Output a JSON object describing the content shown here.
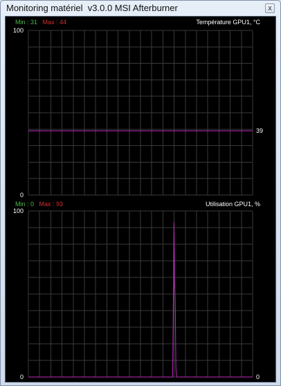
{
  "window": {
    "title": "Monitoring matériel  v3.0.0 MSI Afterburner",
    "close_label": "x"
  },
  "colors": {
    "background": "#000000",
    "grid": "#3a3a3a",
    "line": "#c02cc0",
    "min_text": "#4fb94a",
    "max_text": "#d02f2f"
  },
  "panels": [
    {
      "title": "Température GPU1, °C",
      "min_label": "Min : 31",
      "max_label": "Max : 44",
      "y_max_label": "100",
      "y_min_label": "0",
      "current_label": "39"
    },
    {
      "title": "Utilisation GPU1, %",
      "min_label": "Min : 0",
      "max_label": "Max : 93",
      "y_max_label": "100",
      "y_min_label": "0",
      "current_label": "0"
    }
  ],
  "chart_data": [
    {
      "type": "line",
      "title": "Température GPU1, °C",
      "ylim": [
        0,
        100
      ],
      "grid": true,
      "series": [
        {
          "values": [
            39,
            39,
            39,
            39,
            39,
            39,
            39,
            39,
            39,
            39,
            39,
            39,
            39,
            39,
            39,
            39,
            39,
            39,
            39,
            39,
            39,
            39,
            39,
            39,
            39,
            39,
            39,
            39,
            39,
            39,
            39,
            39,
            39,
            39,
            39,
            39,
            39,
            39,
            39,
            39,
            39,
            39,
            39,
            39,
            39,
            39,
            39,
            39,
            39,
            39,
            39,
            39,
            39,
            39,
            39,
            39,
            39,
            39,
            39,
            39,
            39,
            39,
            39,
            39,
            39,
            39,
            39,
            39,
            39,
            39,
            39,
            39,
            39,
            39,
            39,
            39,
            39,
            39,
            39,
            39
          ]
        }
      ]
    },
    {
      "type": "line",
      "title": "Utilisation GPU1, %",
      "ylim": [
        0,
        100
      ],
      "grid": true,
      "series": [
        {
          "values": [
            0,
            0,
            0,
            0,
            0,
            0,
            0,
            0,
            0,
            0,
            0,
            0,
            0,
            0,
            0,
            0,
            0,
            0,
            0,
            0,
            0,
            0,
            0,
            0,
            0,
            0,
            0,
            0,
            0,
            0,
            0,
            0,
            0,
            0,
            0,
            0,
            0,
            0,
            0,
            0,
            0,
            0,
            0,
            0,
            0,
            0,
            0,
            0,
            0,
            0,
            0,
            0,
            0,
            0,
            0,
            0,
            0,
            0,
            0,
            0,
            0,
            0,
            0,
            0,
            0,
            0,
            0,
            0,
            0,
            0,
            0,
            0,
            0,
            0,
            0,
            0,
            0,
            0,
            0,
            0,
            0,
            0,
            0,
            0,
            0,
            0,
            0,
            0,
            0,
            0,
            0,
            0,
            0,
            0,
            0,
            0,
            0,
            0,
            0,
            0,
            0,
            0,
            0,
            0,
            0,
            0,
            0,
            0,
            0,
            0,
            0,
            0,
            0,
            0,
            0,
            0,
            0,
            0,
            0,
            0,
            0,
            0,
            0,
            0,
            0,
            0,
            0,
            0,
            0,
            0,
            0,
            0,
            0,
            0,
            0,
            0,
            0,
            0,
            0,
            0,
            0,
            0,
            0,
            0,
            0,
            0,
            0,
            0,
            0,
            0,
            0,
            0,
            0,
            0,
            0,
            0,
            0,
            0,
            0,
            0,
            0,
            0,
            0,
            0,
            0,
            0,
            0,
            0,
            0,
            0,
            0,
            0,
            0,
            0,
            0,
            0,
            0,
            0,
            0,
            0,
            0,
            0,
            0,
            0,
            0,
            0,
            0,
            0,
            0,
            0,
            0,
            0,
            0,
            0,
            0,
            0,
            0,
            0,
            0,
            0,
            0,
            0,
            0,
            0,
            0,
            0,
            0,
            0,
            0,
            0,
            0,
            0,
            0,
            0,
            0,
            0,
            0,
            0,
            0,
            0,
            0,
            40,
            93,
            60,
            45,
            5,
            0,
            0,
            0,
            0,
            0,
            0,
            0,
            0,
            0,
            0,
            0,
            0,
            0,
            0,
            0,
            0,
            0,
            0,
            0,
            0,
            0,
            0,
            0,
            0,
            0,
            0,
            0,
            0,
            0,
            0,
            0,
            0,
            0,
            0,
            0,
            0,
            0,
            0,
            0,
            0,
            0,
            0,
            0,
            0,
            0,
            0,
            0,
            0,
            0,
            0,
            0,
            0,
            0,
            0,
            0,
            0,
            0,
            0,
            0,
            0,
            0,
            0,
            0,
            0,
            0,
            0,
            0,
            0,
            0,
            0,
            0,
            0,
            0,
            0,
            0,
            0,
            0,
            0,
            0,
            0,
            0,
            0,
            0,
            0,
            0,
            0,
            0,
            0,
            0,
            0,
            0,
            0,
            0,
            0,
            0,
            0,
            0,
            0,
            0,
            0,
            0,
            0,
            0,
            0,
            0,
            0,
            0,
            0,
            0,
            0,
            0,
            0,
            0,
            0,
            0,
            0,
            0
          ]
        }
      ]
    }
  ]
}
